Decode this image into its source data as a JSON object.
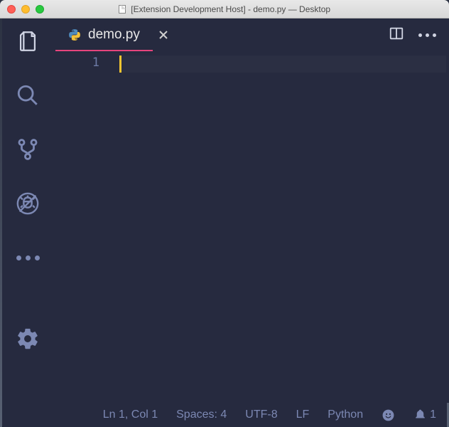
{
  "window": {
    "title": "[Extension Development Host] - demo.py — Desktop"
  },
  "tab": {
    "filename": "demo.py"
  },
  "gutter": {
    "line1": "1"
  },
  "status": {
    "position": "Ln 1, Col 1",
    "spaces": "Spaces: 4",
    "encoding": "UTF-8",
    "eol": "LF",
    "language": "Python",
    "notifications": "1"
  }
}
